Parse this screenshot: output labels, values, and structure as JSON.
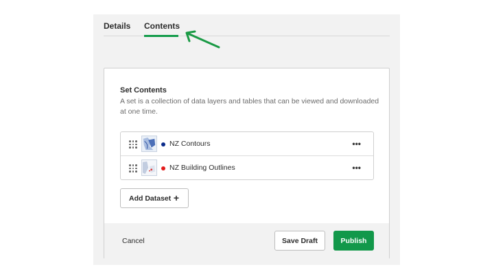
{
  "tabs": [
    {
      "label": "Details",
      "active": false
    },
    {
      "label": "Contents",
      "active": true
    }
  ],
  "card": {
    "title": "Set Contents",
    "description": "A set is a collection of data layers and tables that can be viewed and downloaded at one time."
  },
  "datasets": [
    {
      "label": "NZ Contours",
      "status_color": "#0a2a8a",
      "icon": "map-thumbnail-icon"
    },
    {
      "label": "NZ Building Outlines",
      "status_color": "#e31b1b",
      "icon": "map-thumbnail-icon"
    }
  ],
  "more_label": "•••",
  "add_button": {
    "label": "Add Dataset",
    "plus": "+"
  },
  "footer": {
    "cancel_label": "Cancel",
    "save_draft_label": "Save Draft",
    "publish_label": "Publish"
  },
  "colors": {
    "accent": "#12984a",
    "annotation_arrow": "#1a9a45"
  }
}
